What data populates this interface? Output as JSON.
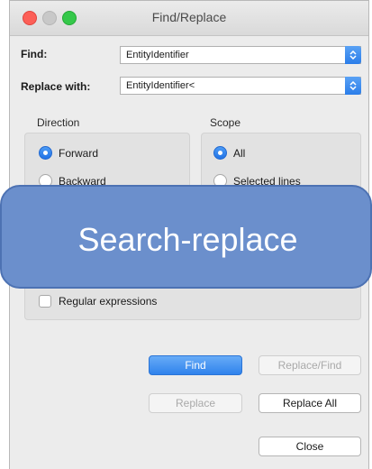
{
  "window": {
    "title": "Find/Replace"
  },
  "find": {
    "label": "Find:",
    "value": "EntityIdentifier"
  },
  "replace": {
    "label": "Replace with:",
    "value": "EntityIdentifier<"
  },
  "direction": {
    "title": "Direction",
    "options": [
      {
        "label": "Forward",
        "selected": true
      },
      {
        "label": "Backward",
        "selected": false
      }
    ]
  },
  "scope": {
    "title": "Scope",
    "options": [
      {
        "label": "All",
        "selected": true
      },
      {
        "label": "Selected lines",
        "selected": false
      }
    ]
  },
  "options": {
    "regex_label": "Regular expressions"
  },
  "buttons": {
    "find": "Find",
    "replace_find": "Replace/Find",
    "replace": "Replace",
    "replace_all": "Replace All",
    "close": "Close"
  },
  "overlay": {
    "text": "Search-replace"
  },
  "colors": {
    "accent": "#2f82ec",
    "overlay": "#6b8fcc"
  }
}
